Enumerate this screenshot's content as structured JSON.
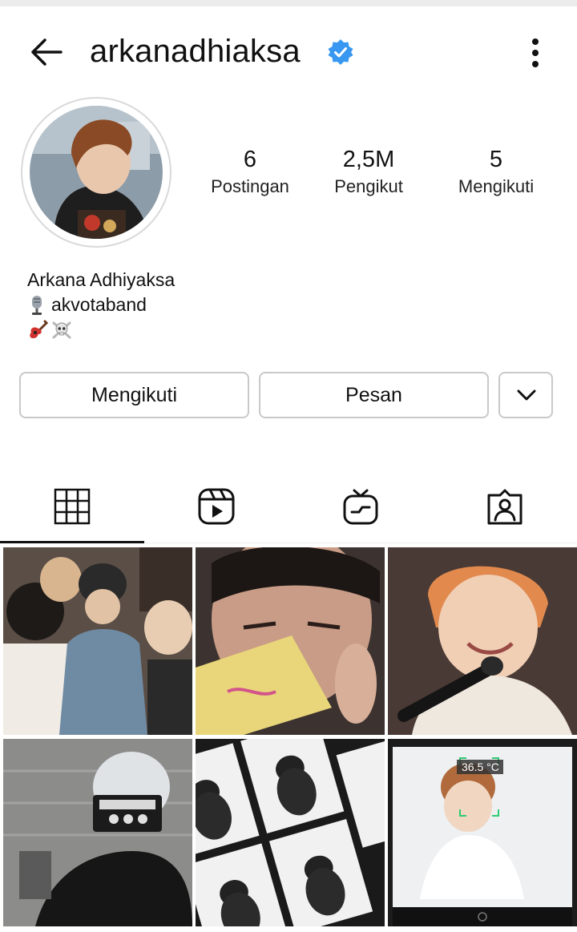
{
  "header": {
    "username": "arkanadhiaksa",
    "back_icon": "arrow-left-icon",
    "verified_icon": "verified-badge-icon",
    "menu_icon": "more-vertical-icon"
  },
  "stats": [
    {
      "value": "6",
      "label": "Postingan"
    },
    {
      "value": "2,5M",
      "label": "Pengikut"
    },
    {
      "value": "5",
      "label": "Mengikuti"
    }
  ],
  "bio": {
    "name": "Arkana Adhiyaksa",
    "line1": "akvotaband",
    "line1_icon": "microphone-icon",
    "line2_icons": [
      "guitar-icon",
      "skull-crossbones-icon"
    ]
  },
  "actions": {
    "follow_label": "Mengikuti",
    "message_label": "Pesan",
    "dropdown_icon": "chevron-down-icon"
  },
  "tabs": [
    "grid-icon",
    "reels-icon",
    "igtv-icon",
    "tagged-icon"
  ],
  "posts": [
    {
      "kind": "photo"
    },
    {
      "kind": "photo"
    },
    {
      "kind": "photo"
    },
    {
      "kind": "photo"
    },
    {
      "kind": "photo"
    },
    {
      "kind": "photo",
      "overlay_text": "36.5 °C"
    }
  ],
  "colors": {
    "verified": "#3897f0",
    "border": "#c9c9c9",
    "text": "#111111"
  }
}
